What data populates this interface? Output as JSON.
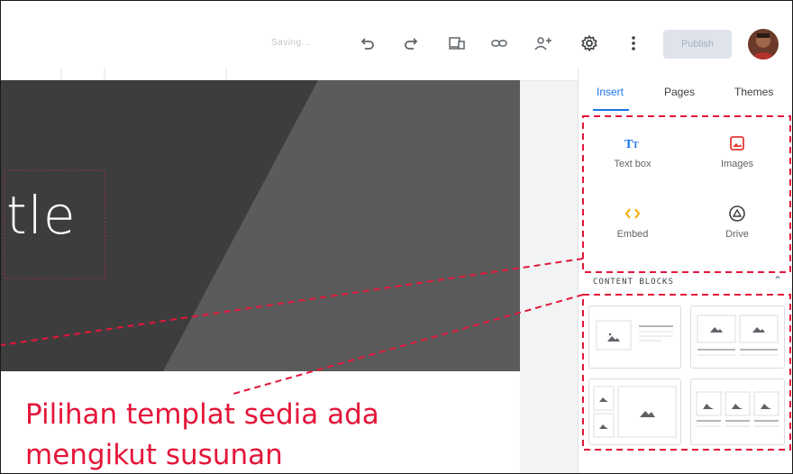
{
  "toolbar": {
    "status_text": "Saving...",
    "undo_icon": "undo-icon",
    "redo_icon": "redo-icon",
    "preview_icon": "device-preview-icon",
    "link_icon": "link-icon",
    "share_icon": "add-person-icon",
    "settings_icon": "gear-icon",
    "more_icon": "more-vertical-icon",
    "publish_label": "Publish"
  },
  "page": {
    "title_fragment": "tle"
  },
  "annotation": {
    "caption_line1": "Pilihan templat sedia ada",
    "caption_line2": "mengikut susunan",
    "color": "#e4163a"
  },
  "panel": {
    "tabs": [
      {
        "label": "Insert",
        "active": true
      },
      {
        "label": "Pages",
        "active": false
      },
      {
        "label": "Themes",
        "active": false
      }
    ],
    "insert_items": [
      {
        "label": "Text box",
        "icon": "text-box-icon"
      },
      {
        "label": "Images",
        "icon": "image-icon"
      },
      {
        "label": "Embed",
        "icon": "embed-code-icon"
      },
      {
        "label": "Drive",
        "icon": "drive-icon"
      }
    ],
    "content_blocks_header": "CONTENT BLOCKS",
    "accent": "#1a73e8"
  }
}
